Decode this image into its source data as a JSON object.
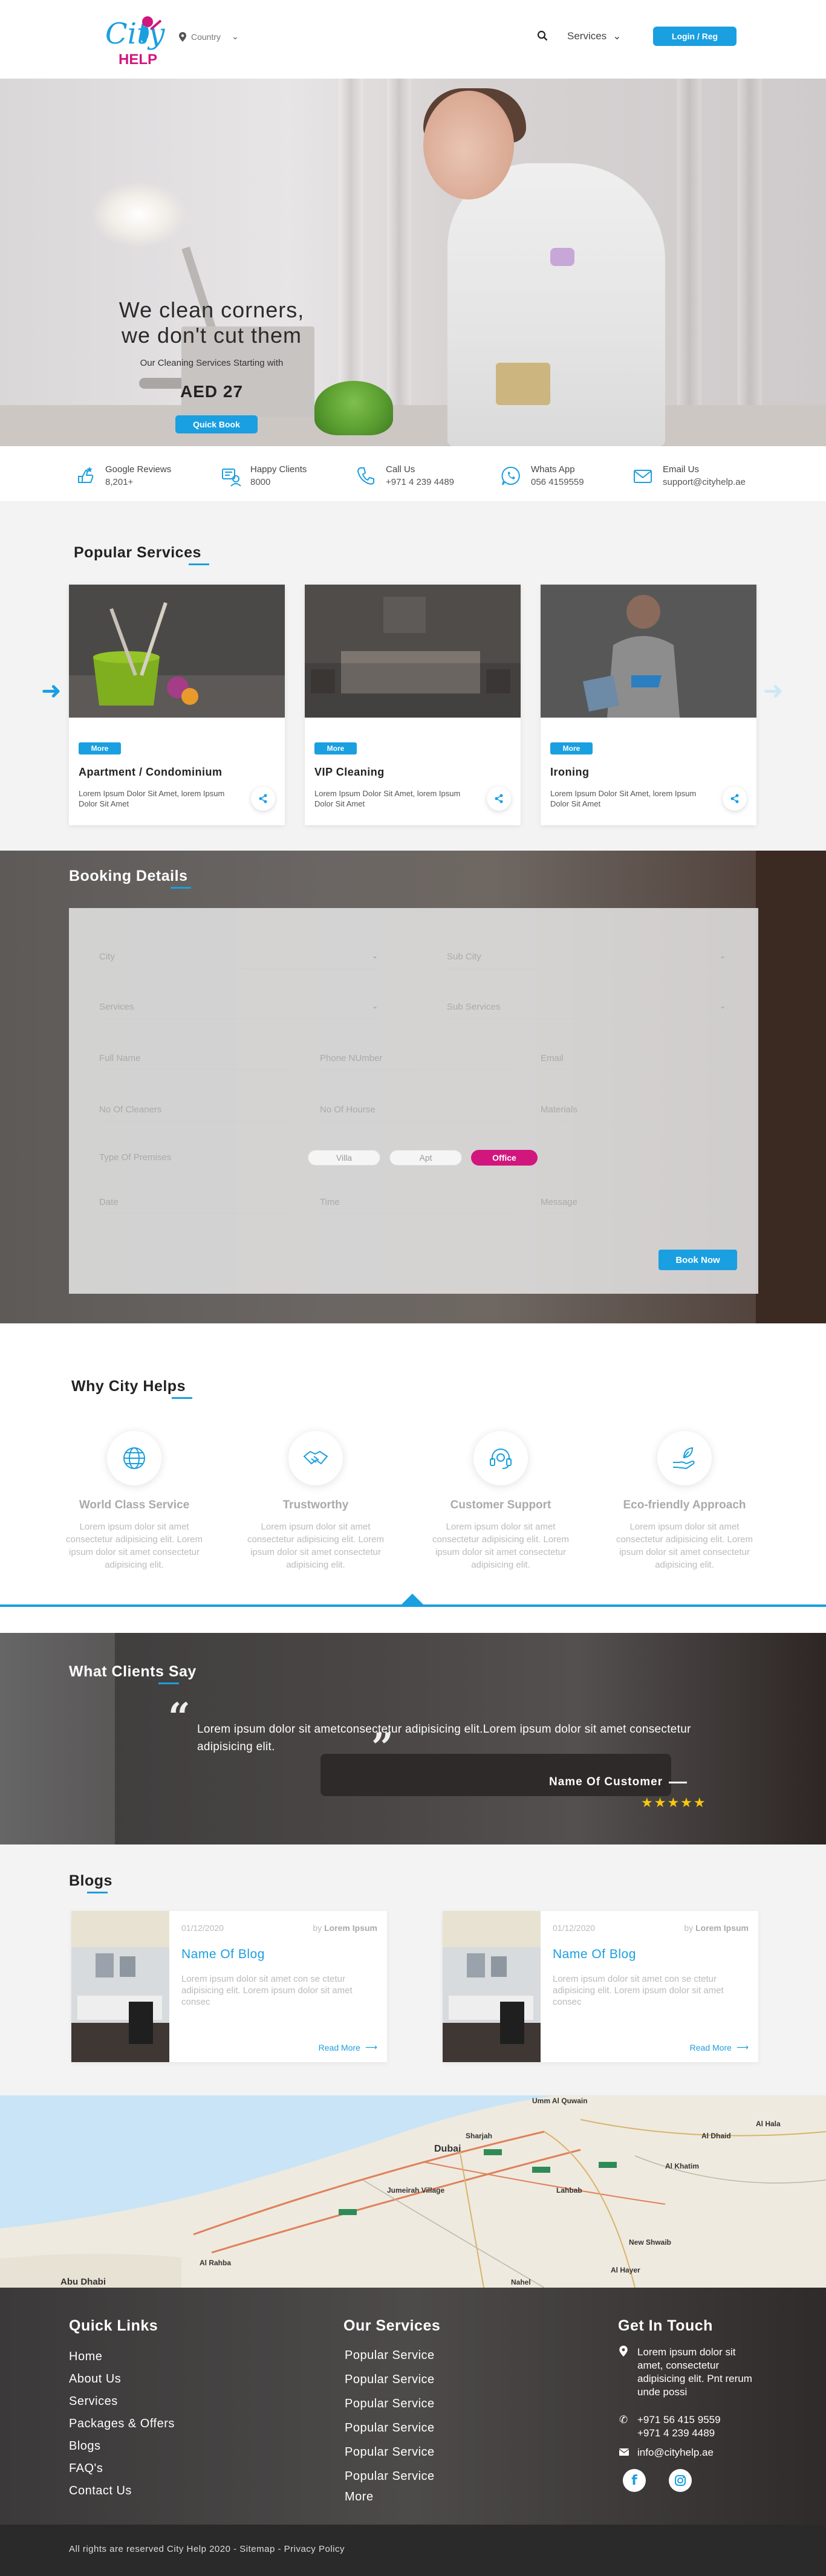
{
  "header": {
    "logo_text": "City HELP",
    "country_label": "Country",
    "services_label": "Services",
    "login_label": "Login / Reg"
  },
  "hero": {
    "title_line1": "We clean corners,",
    "title_line2": "we don't cut them",
    "subtitle": "Our Cleaning Services Starting with",
    "price": "AED 27",
    "button": "Quick Book"
  },
  "stats": [
    {
      "icon": "review-icon",
      "label": "Google Reviews",
      "value": "8,201+"
    },
    {
      "icon": "happy-clients-icon",
      "label": "Happy Clients",
      "value": "8000"
    },
    {
      "icon": "phone-icon",
      "label": "Call Us",
      "value": "+971 4 239 4489"
    },
    {
      "icon": "whatsapp-icon",
      "label": "Whats App",
      "value": "056 4159559"
    },
    {
      "icon": "email-icon",
      "label": "Email Us",
      "value": "support@cityhelp.ae"
    }
  ],
  "popular": {
    "title": "Popular Services",
    "cards": [
      {
        "more": "More",
        "name": "Apartment / Condominium",
        "desc": "Lorem Ipsum Dolor Sit Amet, lorem Ipsum Dolor Sit Amet"
      },
      {
        "more": "More",
        "name": "VIP Cleaning",
        "desc": "Lorem Ipsum Dolor Sit Amet, lorem Ipsum Dolor Sit Amet"
      },
      {
        "more": "More",
        "name": "Ironing",
        "desc": "Lorem Ipsum Dolor Sit Amet, lorem Ipsum Dolor Sit Amet"
      }
    ]
  },
  "booking": {
    "title": "Booking Details",
    "city": "City",
    "sub_city": "Sub City",
    "services": "Services",
    "sub_services": "Sub Services",
    "full_name": "Full Name",
    "phone": "Phone NUmber",
    "email": "Email",
    "cleaners": "No Of Cleaners",
    "hours": "No Of Hourse",
    "materials": "Materials",
    "premises": "Type Of Premises",
    "opt_villa": "Villa",
    "opt_apt": "Apt",
    "opt_office": "Office",
    "date": "Date",
    "time": "Time",
    "message": "Message",
    "button": "Book Now"
  },
  "why": {
    "title": "Why City Helps",
    "items": [
      {
        "icon": "globe-icon",
        "name": "World Class Service",
        "desc": "Lorem ipsum dolor sit amet consectetur adipisicing elit. Lorem ipsum dolor sit amet consectetur adipisicing elit."
      },
      {
        "icon": "handshake-icon",
        "name": "Trustworthy",
        "desc": "Lorem ipsum dolor sit amet consectetur adipisicing elit. Lorem ipsum dolor sit amet consectetur adipisicing elit."
      },
      {
        "icon": "headset-icon",
        "name": "Customer Support",
        "desc": "Lorem ipsum dolor sit amet consectetur adipisicing elit. Lorem ipsum dolor sit amet consectetur adipisicing elit."
      },
      {
        "icon": "eco-hand-icon",
        "name": "Eco-friendly Approach",
        "desc": "Lorem ipsum dolor sit amet consectetur adipisicing elit. Lorem ipsum dolor sit amet consectetur adipisicing elit."
      }
    ]
  },
  "testimonials": {
    "title": "What Clients Say",
    "text": "Lorem ipsum dolor sit ametconsectetur adipisicing elit.Lorem ipsum dolor sit amet consectetur adipisicing elit.",
    "name": "Name Of Customer",
    "stars": "★★★★★",
    "rating": 5
  },
  "blogs": {
    "title": "Blogs",
    "items": [
      {
        "date": "01/12/2020",
        "by": "by",
        "author": "Lorem Ipsum",
        "title": "Name Of Blog",
        "desc": "Lorem ipsum dolor sit amet con se ctetur adipisicing elit. Lorem ipsum dolor sit amet consec",
        "read": "Read More"
      },
      {
        "date": "01/12/2020",
        "by": "by",
        "author": "Lorem Ipsum",
        "title": "Name Of Blog",
        "desc": "Lorem ipsum dolor sit amet con se ctetur adipisicing elit. Lorem ipsum dolor sit amet consec",
        "read": "Read More"
      }
    ]
  },
  "map": {
    "labels": [
      "Umm Al Quwain",
      "Sharjah",
      "Dubai",
      "Jumeirah Village",
      "Lahbab",
      "Al Khatim",
      "New Shwaib",
      "Al Rahba",
      "Abu Dhabi",
      "Al Hayer",
      "Nahel",
      "Al Dhaid",
      "Al Hala"
    ]
  },
  "footer": {
    "quick_title": "Quick Links",
    "quick_links": [
      "Home",
      "About Us",
      "Services",
      "Packages & Offers",
      "Blogs",
      "FAQ's",
      "Contact Us"
    ],
    "services_title": "Our Services",
    "services_links": [
      "Popular Service",
      "Popular Service",
      "Popular Service",
      "Popular Service",
      "Popular Service",
      "Popular Service",
      "More"
    ],
    "contact_title": "Get In Touch",
    "address": "Lorem ipsum dolor sit amet, consectetur adipisicing elit. Pnt rerum unde possi",
    "phone1": "+971 56 415 9559",
    "phone2": "+971 4 239 4489",
    "email": "info@cityhelp.ae",
    "copyright": "All rights are reserved City Help 2020 - Sitemap - Privacy Policy"
  },
  "colors": {
    "accent": "#1a9fe0",
    "pink": "#d1167e",
    "star": "#f6c90e"
  }
}
